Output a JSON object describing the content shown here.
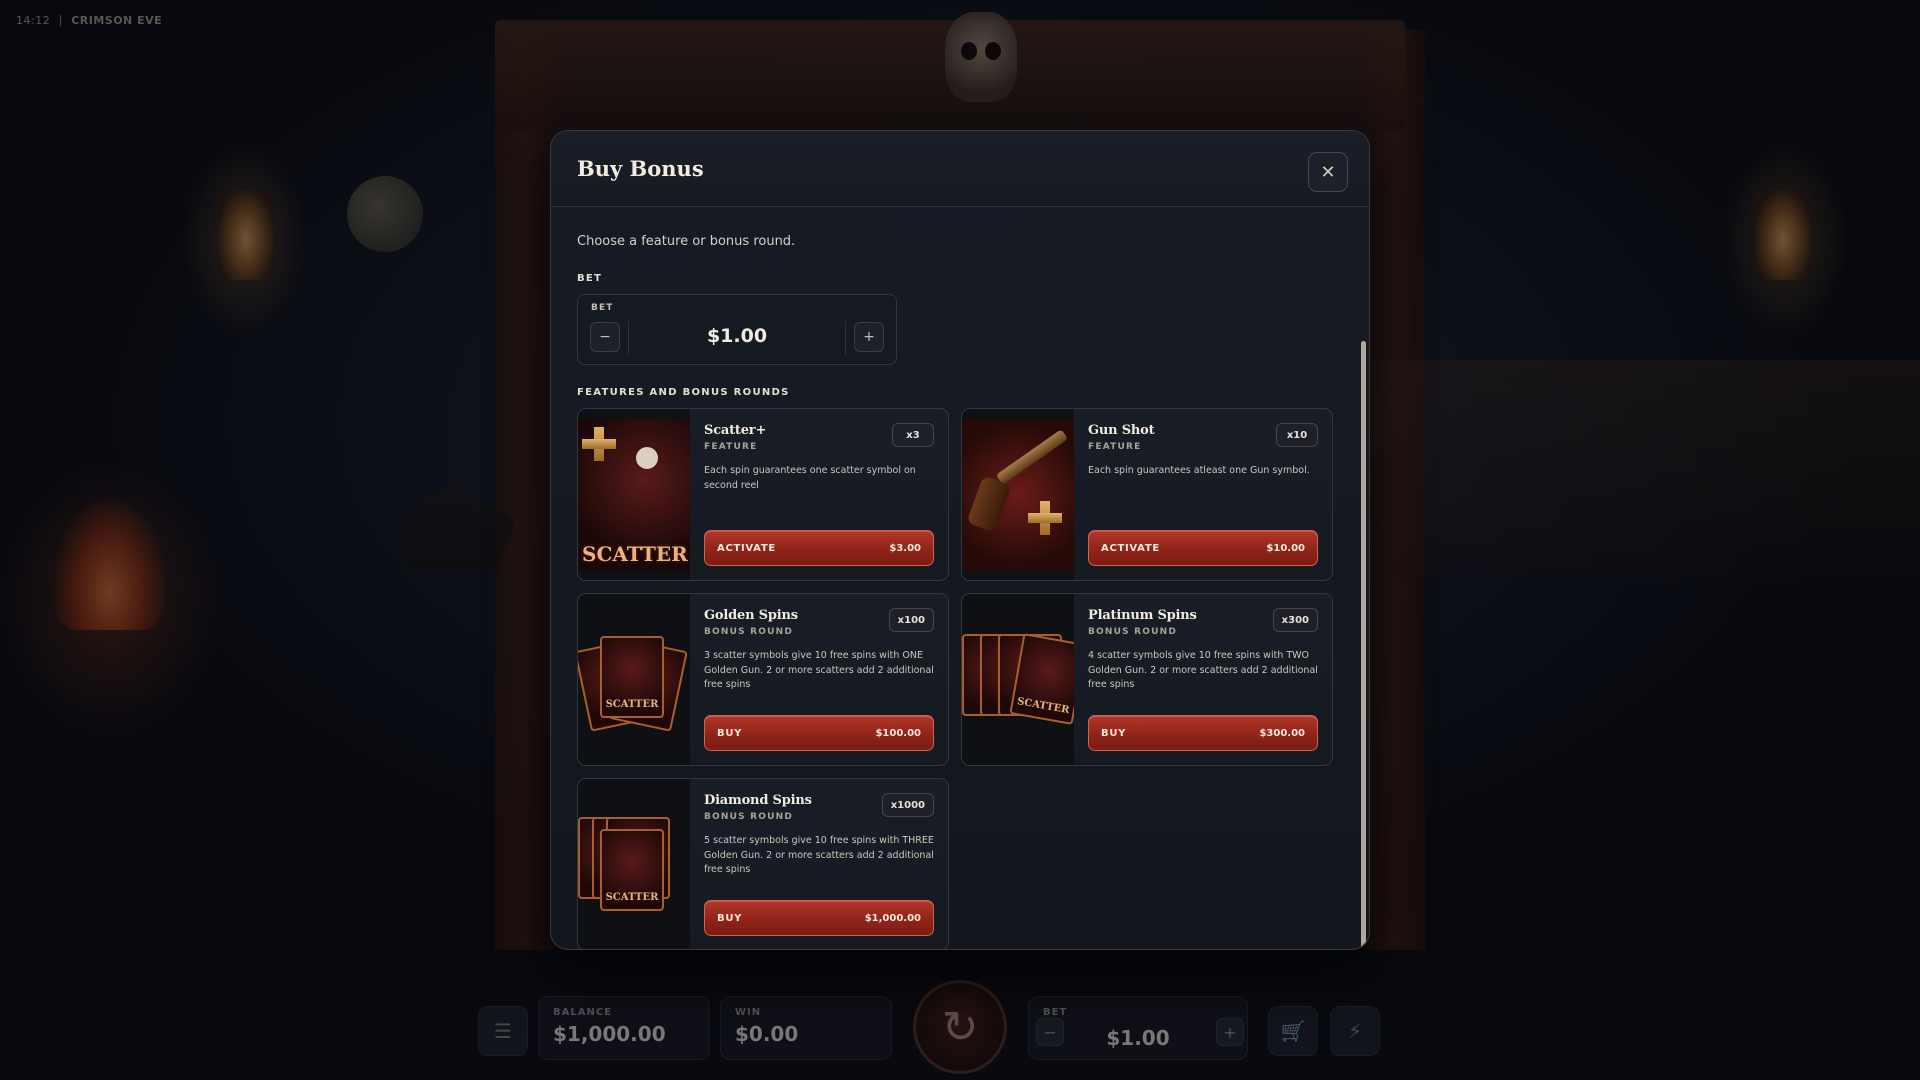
{
  "topbar": {
    "time": "14:12",
    "game_name": "CRIMSON EVE"
  },
  "modal": {
    "title": "Buy Bonus",
    "close_icon": "close-icon",
    "subtitle": "Choose a feature or bonus round.",
    "bet_section_label": "BET",
    "bet": {
      "label": "BET",
      "value": "$1.00",
      "minus": "−",
      "plus": "+"
    },
    "features_label": "FEATURES AND BONUS ROUNDS",
    "cards": [
      {
        "title": "Scatter+",
        "type": "FEATURE",
        "multiplier": "x3",
        "description": "Each spin guarantees one scatter symbol on second reel",
        "action": "ACTIVATE",
        "price": "$3.00",
        "art": "SCATTER"
      },
      {
        "title": "Gun Shot",
        "type": "FEATURE",
        "multiplier": "x10",
        "description": "Each spin guarantees atleast one Gun symbol.",
        "action": "ACTIVATE",
        "price": "$10.00"
      },
      {
        "title": "Golden Spins",
        "type": "BONUS ROUND",
        "multiplier": "x100",
        "description": "3 scatter symbols give 10 free spins with ONE Golden Gun. 2 or more scatters add 2 additional free spins",
        "action": "BUY",
        "price": "$100.00",
        "art": "SCATTER"
      },
      {
        "title": "Platinum Spins",
        "type": "BONUS ROUND",
        "multiplier": "x300",
        "description": "4 scatter symbols give 10 free spins with TWO Golden Gun. 2 or more scatters add 2 additional free spins",
        "action": "BUY",
        "price": "$300.00",
        "art": "SCATTER"
      },
      {
        "title": "Diamond Spins",
        "type": "BONUS ROUND",
        "multiplier": "x1000",
        "description": "5 scatter symbols give 10 free spins with THREE Golden Gun. 2 or more scatters add 2 additional free spins",
        "action": "BUY",
        "price": "$1,000.00",
        "art": "SCATTER"
      }
    ]
  },
  "hud": {
    "menu_icon": "hamburger-icon",
    "balance_label": "BALANCE",
    "balance_value": "$1,000.00",
    "win_label": "WIN",
    "win_value": "$0.00",
    "spin_icon": "spin-icon",
    "bet_label": "BET",
    "bet_value": "$1.00",
    "minus": "−",
    "plus": "+",
    "cart_icon": "cart-icon",
    "turbo_icon": "lightning-icon"
  },
  "colors": {
    "accent_red": "#9a2a1c",
    "gold": "#e2b36a",
    "panel": "#151921"
  }
}
